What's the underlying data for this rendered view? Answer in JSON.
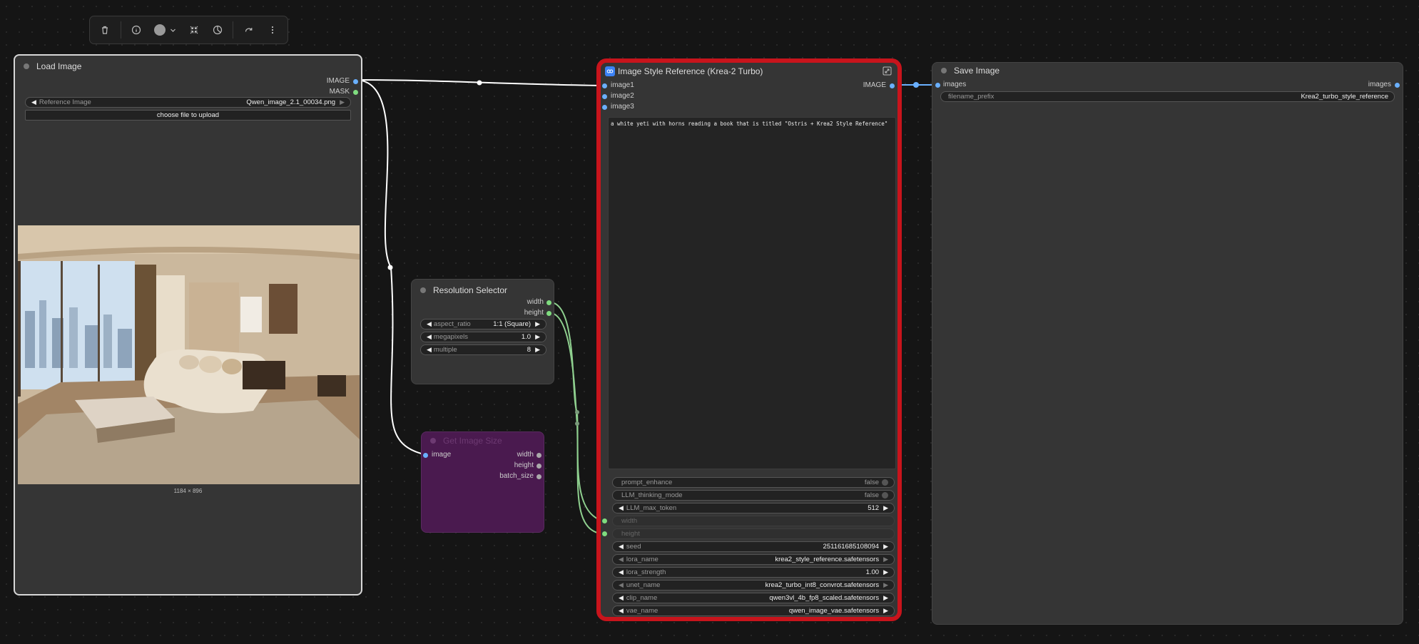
{
  "toolbar": {
    "buttons": [
      "trash-icon",
      "info-icon",
      "color-picker",
      "collapse-icon",
      "palette-icon",
      "redo-icon",
      "more-icon"
    ]
  },
  "load_image": {
    "title": "Load Image",
    "outputs": [
      "IMAGE",
      "MASK"
    ],
    "image_widget_label": "Reference Image",
    "image_widget_value": "Qwen_image_2.1_00034.png",
    "upload_label": "choose file to upload",
    "dimensions": "1184 × 896"
  },
  "resolution_selector": {
    "title": "Resolution Selector",
    "outputs": [
      "width",
      "height"
    ],
    "widgets": [
      {
        "label": "aspect_ratio",
        "value": "1:1 (Square)"
      },
      {
        "label": "megapixels",
        "value": "1.0"
      },
      {
        "label": "multiple",
        "value": "8"
      }
    ]
  },
  "get_image_size": {
    "title": "Get Image Size",
    "input": "image",
    "outputs": [
      "width",
      "height",
      "batch_size"
    ]
  },
  "style_reference": {
    "title": "Image Style Reference (Krea-2 Turbo)",
    "inputs": [
      "image1",
      "image2",
      "image3"
    ],
    "output": "IMAGE",
    "prompt": "a white yeti with horns reading a book that is titled \"Ostris + Krea2 Style Reference\"",
    "toggles": [
      {
        "label": "prompt_enhance",
        "value": "false"
      },
      {
        "label": "LLM_thinking_mode",
        "value": "false"
      }
    ],
    "llm_max_token": {
      "label": "LLM_max_token",
      "value": "512"
    },
    "linked_inputs": [
      "width",
      "height"
    ],
    "widgets": [
      {
        "label": "seed",
        "value": "251161685108094"
      },
      {
        "label": "lora_name",
        "value": "krea2_style_reference.safetensors"
      },
      {
        "label": "lora_strength",
        "value": "1.00"
      },
      {
        "label": "unet_name",
        "value": "krea2_turbo_int8_convrot.safetensors"
      },
      {
        "label": "clip_name",
        "value": "qwen3vl_4b_fp8_scaled.safetensors"
      },
      {
        "label": "vae_name",
        "value": "qwen_image_vae.safetensors"
      }
    ]
  },
  "save_image": {
    "title": "Save Image",
    "input": "images",
    "output": "images",
    "prefix_label": "filename_prefix",
    "prefix_value": "Krea2_turbo_style_reference"
  },
  "colors": {
    "highlight": "#c8141c",
    "image_link": "#ffffff",
    "int_link": "#8fd08f",
    "socket_image": "#6ab0ff",
    "gis_bg": "#4a1a4f"
  }
}
